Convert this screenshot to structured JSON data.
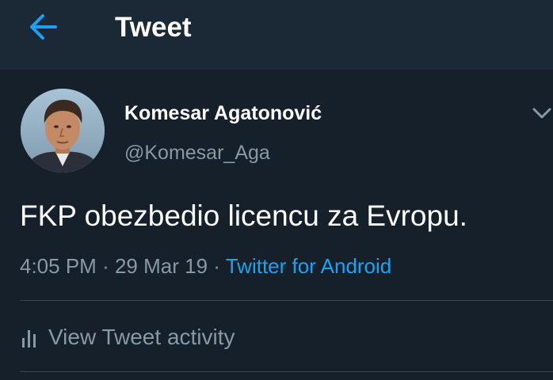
{
  "header": {
    "back_icon": "arrow-left-icon",
    "title": "Tweet"
  },
  "tweet": {
    "author": {
      "display_name": "Komesar Agatonović",
      "handle": "@Komesar_Aga",
      "avatar": "profile-photo"
    },
    "menu_icon": "chevron-down-icon",
    "text": "FKP obezbedio licencu za Evropu.",
    "time": "4:05 PM",
    "separator": "·",
    "date": "29 Mar 19",
    "source": "Twitter for Android"
  },
  "actions": {
    "activity_icon": "bar-chart-icon",
    "activity_label": "View Tweet activity"
  },
  "colors": {
    "background": "#15202b",
    "header": "#1b2836",
    "accent": "#1da1f2",
    "muted_text": "#8899a6",
    "divider": "#38444d"
  }
}
